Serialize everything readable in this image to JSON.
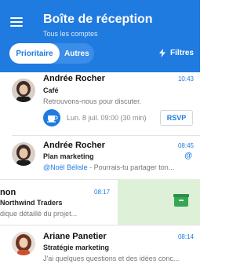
{
  "header": {
    "title": "Boîte de réception",
    "subtitle": "Tous les comptes",
    "tabs": [
      {
        "label": "Prioritaire",
        "active": true
      },
      {
        "label": "Autres",
        "active": false
      }
    ],
    "filters_label": "Filtres",
    "color": "#1f7be0"
  },
  "emails": [
    {
      "sender": "Andrée Rocher",
      "time": "10:43",
      "subject": "Café",
      "preview": "Retrouvons-nous pour discuter.",
      "event": {
        "text": "Lun. 8 juil. 09:00 (30 min)",
        "rsvp_label": "RSVP"
      }
    },
    {
      "sender": "Andrée Rocher",
      "time": "08:45",
      "subject": "Plan marketing",
      "mention": "@Noël Bélisle",
      "preview_rest": " - Pourrais-tu partager ton...",
      "at_symbol": "@"
    },
    {
      "sender": "non",
      "time": "08:17",
      "subject": "Northwind Traders",
      "preview": "dique détaillé du projet...",
      "swipe_action": "archive-icon",
      "swipe_color": "#dff0d9"
    },
    {
      "sender": "Ariane Panetier",
      "time": "08:14",
      "subject": "Stratégie marketing",
      "preview": "J'ai quelques questions et des idées conc..."
    }
  ]
}
